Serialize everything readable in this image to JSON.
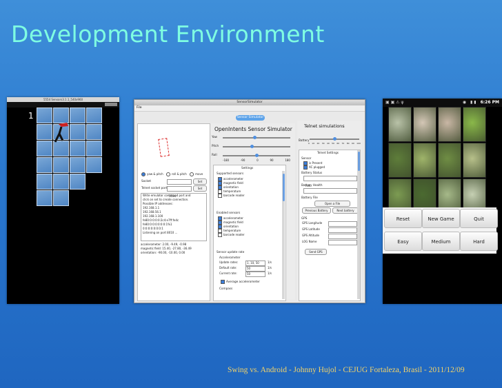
{
  "slide": {
    "title": "Development Environment",
    "footer": "Swing vs. Android - Johnny Hujol - CEJUG Fortaleza, Brasil - 2011/12/09"
  },
  "left_emulator": {
    "window_title": "5554 Sensors3.1.1_540x960",
    "tile_number": "1"
  },
  "sensor_sim": {
    "window_title": "SensorSimulator",
    "menu": "File",
    "tab": "Sensor Simulator",
    "main_title": "OpenIntents Sensor Simulator",
    "sliders": [
      "Yaw",
      "Pitch",
      "Roll"
    ],
    "axis_ticks": [
      "-180",
      "-90",
      "0",
      "90",
      "180"
    ],
    "radio_options": [
      "yaw & pitch",
      "roll & pitch",
      "move"
    ],
    "socket_label": "Socket",
    "socket_value": "8010",
    "telnet_label": "Telnet socket port",
    "telnet_value": "5554",
    "set_label": "Set",
    "log_lines": [
      "Write emulator command port and",
      "click on set to create connection.",
      "Possible IP addresses:",
      "192.168.1.1",
      "192.168.56.1",
      "192.168.1.100",
      "fe80:0:0:0:0:2c4:e7ff:fe4c",
      "fe80:0:0:0:0:0:0:1%1",
      "0:0:0:0:0:0:0:1",
      "Listening on port 8010 ..."
    ],
    "readings": [
      "accelerometer: 2.00, -9.49, -0.98",
      "magnetic field: 15.40, -27.80, -36.49",
      "orientation: -90.00, -10.00, 0.00"
    ],
    "settings_title": "Settings",
    "supported_title": "Supported sensors",
    "supported_sensors": [
      {
        "label": "accelerometer",
        "checked": true
      },
      {
        "label": "magnetic field",
        "checked": true
      },
      {
        "label": "orientation",
        "checked": true
      },
      {
        "label": "temperature",
        "checked": false
      },
      {
        "label": "barcode reader",
        "checked": false
      }
    ],
    "enabled_title": "Enabled sensors",
    "enabled_sensors": [
      {
        "label": "accelerometer",
        "checked": true
      },
      {
        "label": "magnetic field",
        "checked": true
      },
      {
        "label": "orientation",
        "checked": true
      },
      {
        "label": "temperature",
        "checked": false
      },
      {
        "label": "barcode reader",
        "checked": false
      }
    ],
    "update_title": "Sensor update rate",
    "accel_label": "Accelerometer",
    "update_rates": [
      {
        "label": "Update rates:",
        "value": "1, 10, 50",
        "unit": "1/s"
      },
      {
        "label": "Default rate:",
        "value": "50",
        "unit": "1/s"
      },
      {
        "label": "Current rate:",
        "value": "50",
        "unit": "1/s"
      }
    ],
    "average_label": "Average accelerometer",
    "compass_label": "Compass",
    "telnet": {
      "title": "Telnet simulations",
      "battery_label": "Battery",
      "battery_ticks": [
        "0",
        "10",
        "20",
        "30",
        "40",
        "50",
        "60",
        "70",
        "80",
        "90",
        "100"
      ],
      "settings_button": "Telnet Settings",
      "sensor_group": "Sensor",
      "sensor_options": [
        {
          "label": "is Present",
          "checked": true
        },
        {
          "label": "AC plugged",
          "checked": true
        }
      ],
      "status_label": "Battery Status",
      "status_value": "Full",
      "health_label": "Battery Health",
      "health_value": "",
      "file_label": "Battery File",
      "open_file": "Open a File",
      "prev_button": "Previous Battery",
      "next_button": "Next battery",
      "gps_title": "GPS",
      "gps_fields": [
        "GPS Longitude",
        "GPS Latitude",
        "GPS Altitude",
        "LOG Name"
      ],
      "send_gps": "Send GPS"
    }
  },
  "phone": {
    "status_time": "6:26 PM",
    "buttons_row1": [
      "Reset",
      "New Game",
      "Quit"
    ],
    "buttons_row2": [
      "Easy",
      "Medium",
      "Hard"
    ]
  }
}
